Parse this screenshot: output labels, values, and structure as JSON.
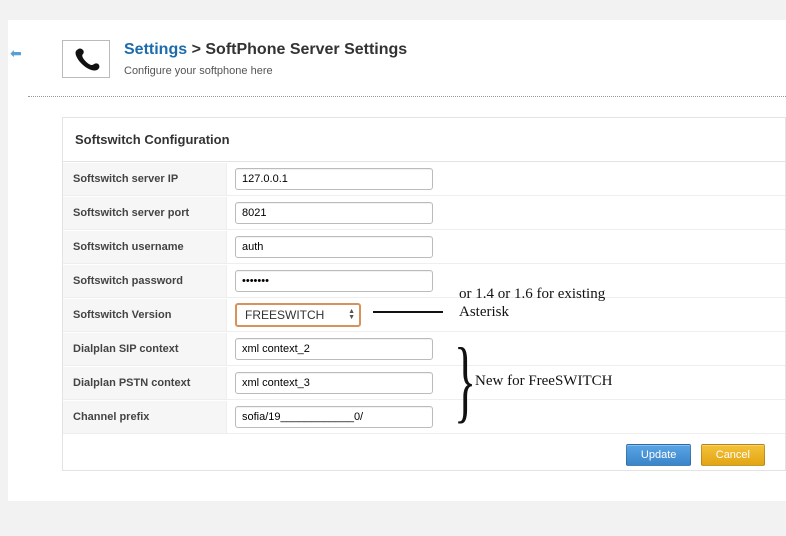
{
  "breadcrumb": {
    "root": "Settings",
    "sep": ">",
    "page": "SoftPhone Server Settings"
  },
  "subhead": "Configure your softphone here",
  "panel_title": "Softswitch Configuration",
  "fields": {
    "server_ip": {
      "label": "Softswitch server IP",
      "value": "127.0.0.1"
    },
    "server_port": {
      "label": "Softswitch server port",
      "value": "8021"
    },
    "username": {
      "label": "Softswitch username",
      "value": "auth"
    },
    "password": {
      "label": "Softswitch password",
      "value": "•••••••"
    },
    "version": {
      "label": "Softswitch Version",
      "value": "FREESWITCH"
    },
    "sip_ctx": {
      "label": "Dialplan SIP context",
      "value": "xml context_2"
    },
    "pstn_ctx": {
      "label": "Dialplan PSTN context",
      "value": "xml context_3"
    },
    "chan_prefix": {
      "label": "Channel prefix",
      "value": "sofia/19____________0/"
    }
  },
  "annotations": {
    "asterisk": "or 1.4 or 1.6 for existing Asterisk",
    "freeswitch": "New for FreeSWITCH"
  },
  "buttons": {
    "update": "Update",
    "cancel": "Cancel"
  }
}
